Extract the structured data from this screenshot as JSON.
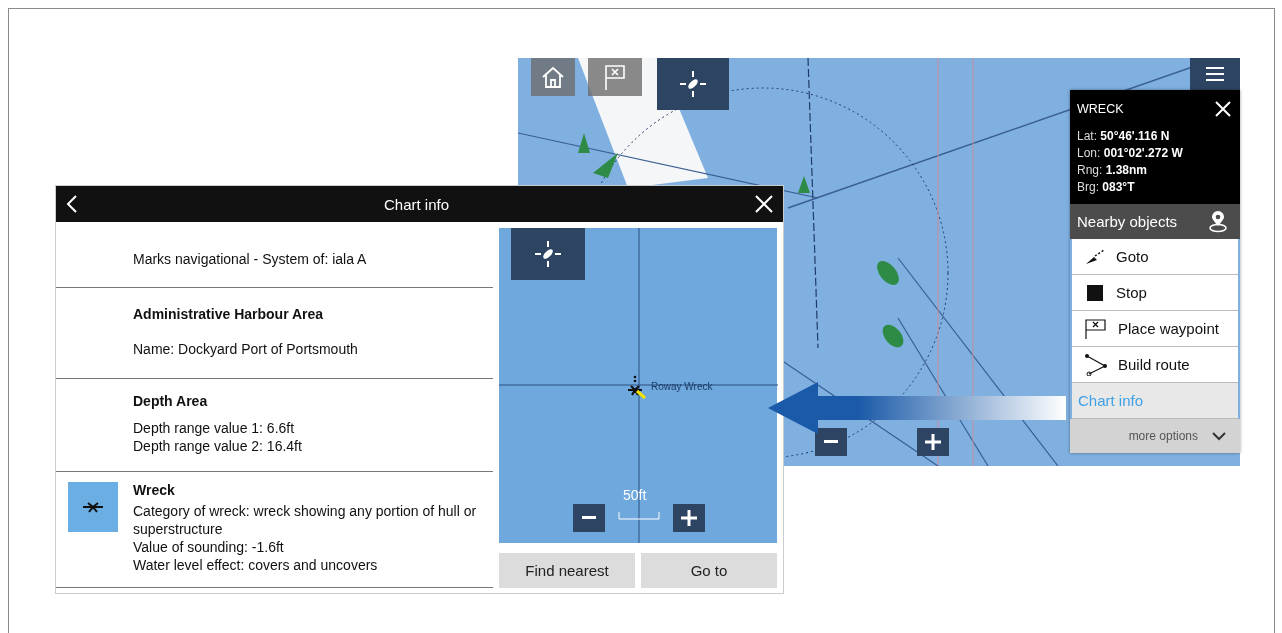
{
  "back_screen": {
    "menu": {
      "title": "WRECK",
      "details": [
        {
          "label": "Lat: ",
          "value": "50°46'.116 N"
        },
        {
          "label": "Lon: ",
          "value": "001°02'.272 W"
        },
        {
          "label": "Rng: ",
          "value": "1.38nm"
        },
        {
          "label": "Brg: ",
          "value": "083°T"
        }
      ],
      "nearby": "Nearby objects",
      "actions": [
        {
          "kind": "goto",
          "label": "Goto",
          "selected": false
        },
        {
          "kind": "stop",
          "label": "Stop",
          "selected": false
        },
        {
          "kind": "waypoint",
          "label": "Place waypoint",
          "selected": false
        },
        {
          "kind": "route",
          "label": "Build route",
          "selected": false
        },
        {
          "kind": "info",
          "label": "Chart info",
          "selected": true
        }
      ],
      "more": "more options"
    }
  },
  "chart_info": {
    "title": "Chart info",
    "items": [
      {
        "lines": [
          "Marks navigational - System of: iala A"
        ],
        "icon": false
      },
      {
        "title": "Administrative Harbour Area",
        "lines": [
          "Name: Dockyard Port of Portsmouth"
        ],
        "icon": false
      },
      {
        "title": "Depth Area",
        "lines": [
          "Depth range value 1: 6.6ft",
          "Depth range value 2: 16.4ft"
        ],
        "icon": false
      },
      {
        "title": "Wreck",
        "lines": [
          "Category of wreck: wreck showing any portion of hull or superstructure",
          "Value of sounding: -1.6ft",
          "Water level effect: covers and uncovers"
        ],
        "icon": true
      }
    ],
    "map_label": "Roway Wreck",
    "scale": "50ft",
    "buttons": [
      "Find nearest",
      "Go to"
    ]
  }
}
